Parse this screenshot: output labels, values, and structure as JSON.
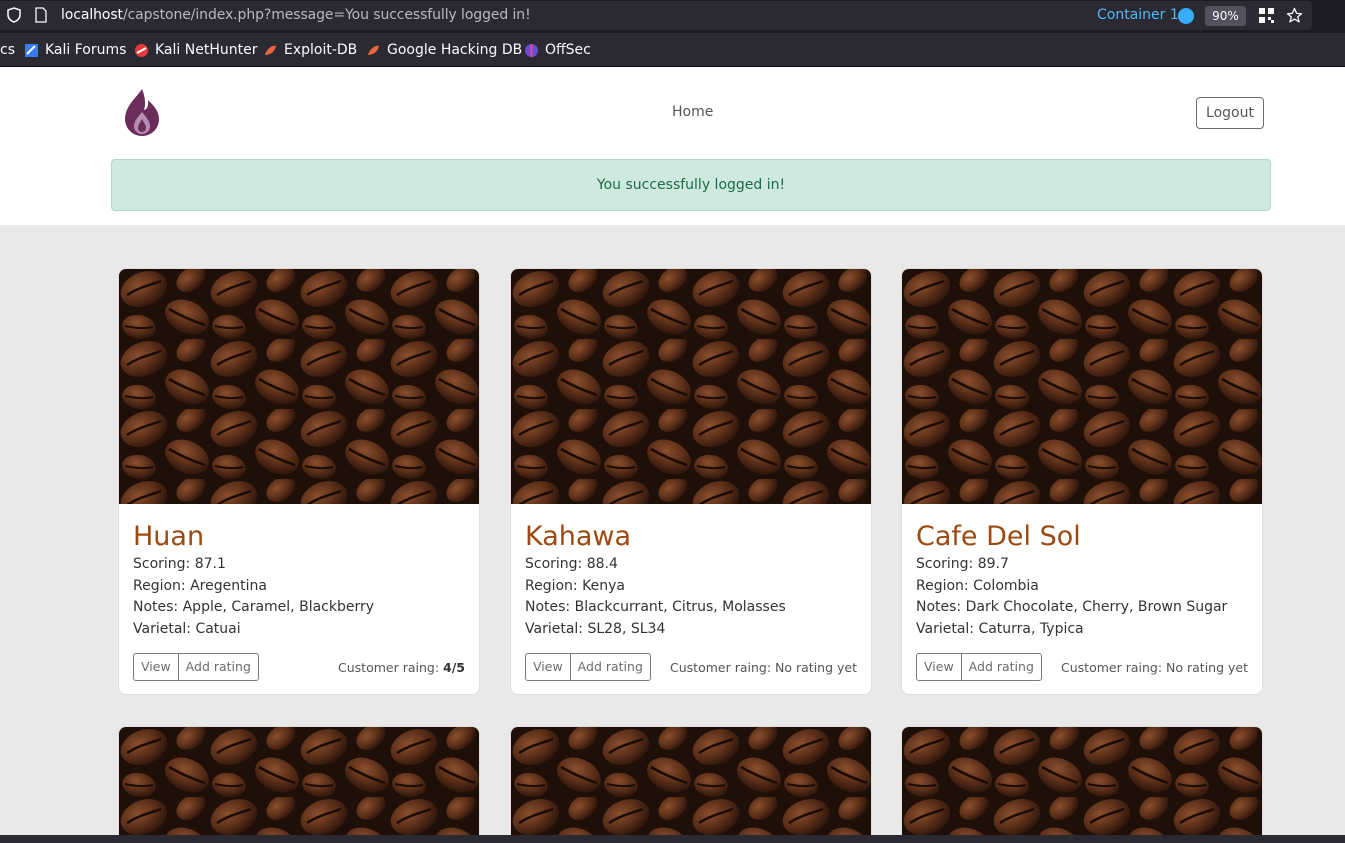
{
  "browser": {
    "url_host": "localhost",
    "url_path": "/capstone/index.php?message=You successfully logged in!",
    "container_label": "Container 1",
    "zoom": "90%",
    "bookmarks": [
      {
        "label": "cs"
      },
      {
        "label": "Kali Forums"
      },
      {
        "label": "Kali NetHunter"
      },
      {
        "label": "Exploit-DB"
      },
      {
        "label": "Google Hacking DB"
      },
      {
        "label": "OffSec"
      }
    ]
  },
  "header": {
    "nav_home": "Home",
    "logout_label": "Logout"
  },
  "alert": {
    "message": "You successfully logged in!"
  },
  "cards": [
    {
      "title": "Huan",
      "scoring": "Scoring: 87.1",
      "region": "Region: Aregentina",
      "notes": "Notes: Apple, Caramel, Blackberry",
      "varietal": "Varietal: Catuai",
      "view_label": "View",
      "add_rating_label": "Add rating",
      "rating_prefix": "Customer raing: ",
      "rating_value": "4/5"
    },
    {
      "title": "Kahawa",
      "scoring": "Scoring: 88.4",
      "region": "Region: Kenya",
      "notes": "Notes: Blackcurrant, Citrus, Molasses",
      "varietal": "Varietal: SL28, SL34",
      "view_label": "View",
      "add_rating_label": "Add rating",
      "rating_prefix": "Customer raing: No rating yet",
      "rating_value": ""
    },
    {
      "title": "Cafe Del Sol",
      "scoring": "Scoring: 89.7",
      "region": "Region: Colombia",
      "notes": "Notes: Dark Chocolate, Cherry, Brown Sugar",
      "varietal": "Varietal: Caturra, Typica",
      "view_label": "View",
      "add_rating_label": "Add rating",
      "rating_prefix": "Customer raing: No rating yet",
      "rating_value": ""
    }
  ],
  "colors": {
    "title": "#9c4a12",
    "alert_bg": "#d0e9e0",
    "alert_text": "#1b6c48",
    "logo": "#6b2d5c"
  }
}
